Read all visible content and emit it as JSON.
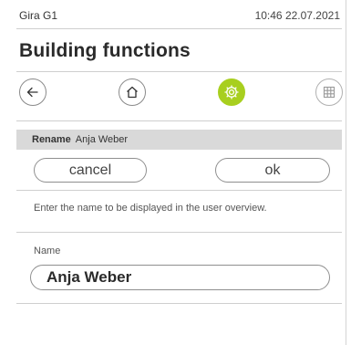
{
  "status": {
    "device_name": "Gira G1",
    "datetime": "10:46 22.07.2021"
  },
  "page": {
    "title": "Building functions"
  },
  "nav": {
    "back_icon": "back-arrow-icon",
    "home_icon": "home-icon",
    "settings_icon": "settings-gear-icon",
    "grid_icon": "grid-icon",
    "accent_color": "#a8cf1f"
  },
  "rename": {
    "label": "Rename",
    "current_name": "Anja Weber"
  },
  "actions": {
    "cancel_label": "cancel",
    "ok_label": "ok"
  },
  "hint": "Enter the name to be displayed in the user overview.",
  "field": {
    "label": "Name",
    "value": "Anja Weber"
  }
}
